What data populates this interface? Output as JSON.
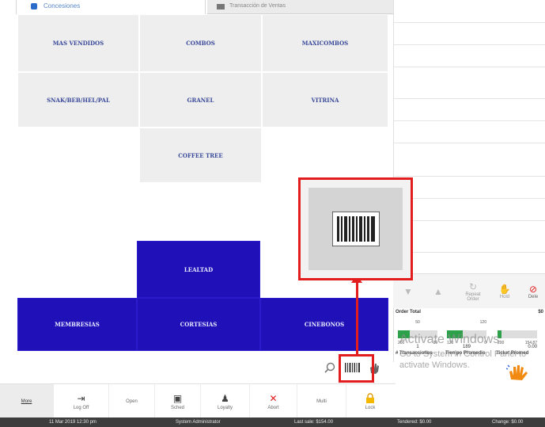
{
  "tabs": [
    {
      "label": "Concesiones"
    },
    {
      "label": "Transacción de Ventas"
    }
  ],
  "categories": {
    "mas_vendidos": "MAS VENDIDOS",
    "combos": "COMBOS",
    "maxicombos": "MAXICOMBOS",
    "snak": "SNAK/BEB/HEL/PAL",
    "granel": "GRANEL",
    "vitrina": "VITRINA",
    "coffee_tree": "COFFEE TREE",
    "lealtad": "LEALTAD",
    "membresias": "MEMBRESIAS",
    "cortesias": "CORTESIAS",
    "cinebonos": "CINEBONOS"
  },
  "controls": {
    "repeat_order": "Repeat Order",
    "hold": "Hold",
    "delete": "Dele"
  },
  "order_total": {
    "label": "Order Total",
    "value": "$0"
  },
  "gauges": [
    {
      "top_left": "50",
      "top_right": "120",
      "min": "200",
      "max_left": "30",
      "value": "1",
      "fill_pct": 30
    },
    {
      "top_left": "",
      "top_right": "120",
      "min": "120",
      "max_left": "0",
      "value": "189",
      "fill_pct": 40
    },
    {
      "top_left": "",
      "top_right": "",
      "min": "200",
      "max_left": "154.87",
      "value": "0.00",
      "fill_pct": 10
    }
  ],
  "kpis": {
    "transacciones": "# Transacciones",
    "tiempo": "Tiempo Promedio",
    "ticket": "Ticket Promed"
  },
  "watermark": {
    "line1": "Activate Windows",
    "line2": "Go to System in Control Panel to activate Windows."
  },
  "toolbar": {
    "more": "More",
    "log_off": "Log Off",
    "open": "Open",
    "sched": "Sched",
    "loyalty": "Loyalty",
    "abort": "Abort",
    "multi": "Multi",
    "lock": "Lock"
  },
  "status": {
    "datetime": "11 Mar 2019 12:30 pm",
    "user": "System Administrator",
    "last_sale": "Last sale: $154.00",
    "tendered": "Tendered: $0.00",
    "change": "Change: $0.00"
  },
  "colors": {
    "highlight": "#e31d1d",
    "blue_button": "#1f10b8",
    "grey_button": "#eeeeee"
  }
}
